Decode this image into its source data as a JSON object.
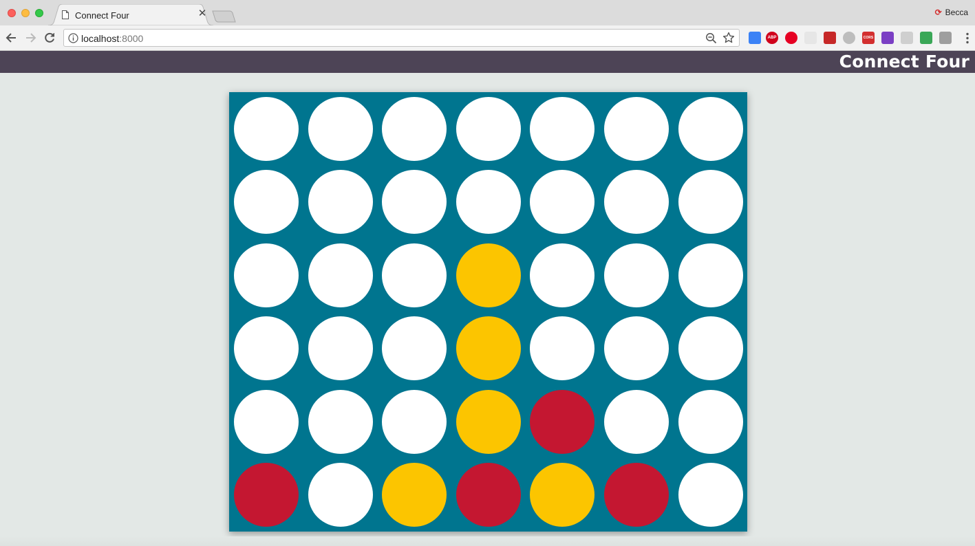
{
  "browser": {
    "tab_title": "Connect Four",
    "profile_name": "Becca",
    "url_host": "localhost",
    "url_port": ":8000",
    "extensions": [
      {
        "name": "eyedropper-extension-icon",
        "color": "#3b82f6"
      },
      {
        "name": "adblock-plus-icon",
        "color": "#d0021b",
        "text": "ABP"
      },
      {
        "name": "pinterest-icon",
        "color": "#e60023"
      },
      {
        "name": "blank-extension-icon",
        "color": "#e6e6e6"
      },
      {
        "name": "red-puzzle-extension-icon",
        "color": "#c62828"
      },
      {
        "name": "grey-face-extension-icon",
        "color": "#bdbdbd"
      },
      {
        "name": "cors-extension-icon",
        "color": "#d32f2f",
        "text": "CORS"
      },
      {
        "name": "purple-check-extension-icon",
        "color": "#7b3fc4"
      },
      {
        "name": "grey-toggle-extension-icon",
        "color": "#cfcfcf"
      },
      {
        "name": "rainbow-extension-icon",
        "color": "#3aa757"
      },
      {
        "name": "wave-extension-icon",
        "color": "#9e9e9e"
      }
    ]
  },
  "app": {
    "title": "Connect Four",
    "colors": {
      "header": "#4d4456",
      "board": "#00758f",
      "empty": "#ffffff",
      "yellow": "#fcc500",
      "red": "#c41731"
    }
  },
  "game": {
    "columns": 7,
    "rows": 6,
    "board": [
      [
        "empty",
        "empty",
        "empty",
        "empty",
        "empty",
        "empty",
        "empty"
      ],
      [
        "empty",
        "empty",
        "empty",
        "empty",
        "empty",
        "empty",
        "empty"
      ],
      [
        "empty",
        "empty",
        "empty",
        "yellow",
        "empty",
        "empty",
        "empty"
      ],
      [
        "empty",
        "empty",
        "empty",
        "yellow",
        "empty",
        "empty",
        "empty"
      ],
      [
        "empty",
        "empty",
        "empty",
        "yellow",
        "red",
        "empty",
        "empty"
      ],
      [
        "red",
        "empty",
        "yellow",
        "red",
        "yellow",
        "red",
        "empty"
      ]
    ]
  }
}
